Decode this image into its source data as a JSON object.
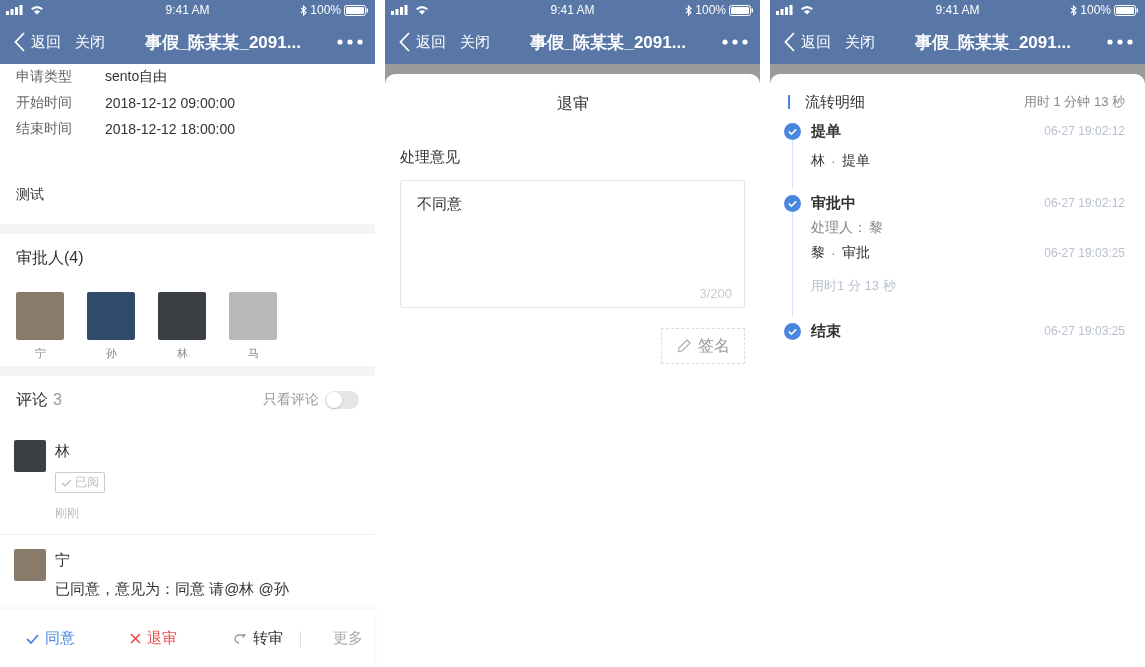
{
  "screens": [
    {
      "kind": "detail",
      "status_bar": {
        "time": "9:41 AM",
        "battery": "100%"
      },
      "nav_bar": {
        "back": "返回",
        "close": "关闭",
        "title": "事假_陈某某_2091..."
      },
      "fields": [
        {
          "label": "申请类型",
          "value": "sento自由"
        },
        {
          "label": "开始时间",
          "value": "2018-12-12 09:00:00"
        },
        {
          "label": "结束时间",
          "value": "2018-12-12 18:00:00"
        }
      ],
      "note": "测试",
      "approvers": {
        "title": "审批人(4)",
        "people": [
          {
            "name": "宁"
          },
          {
            "name": "孙"
          },
          {
            "name": "林"
          },
          {
            "name": "马"
          }
        ]
      },
      "comments": {
        "title": "评论",
        "count": "3",
        "filter": {
          "label": "只看评论",
          "on": false
        },
        "items": [
          {
            "author": "林",
            "badge": "已阅",
            "time": "刚刚"
          },
          {
            "author": "宁",
            "text": "已同意，意见为：同意 请@林 @孙"
          }
        ]
      },
      "actions": [
        {
          "kind": "approve",
          "label": "同意"
        },
        {
          "kind": "reject",
          "label": "退审"
        },
        {
          "kind": "transfer",
          "label": "转审"
        },
        {
          "kind": "more",
          "label": "更多"
        }
      ]
    },
    {
      "kind": "reject_sheet",
      "status_bar": {
        "time": "9:41 AM",
        "battery": "100%"
      },
      "nav_bar": {
        "back": "返回",
        "close": "关闭",
        "title": "事假_陈某某_2091..."
      },
      "sheet": {
        "title": "退审",
        "field_label": "处理意见",
        "value": "不同意",
        "counter": "3/200",
        "sign_button": "签名"
      }
    },
    {
      "kind": "flow_sheet",
      "status_bar": {
        "time": "9:41 AM",
        "battery": "100%"
      },
      "nav_bar": {
        "back": "返回",
        "close": "关闭",
        "title": "事假_陈某某_2091..."
      },
      "sheet": {
        "title": "流转明细",
        "total": "用时 1 分钟 13 秒",
        "steps": [
          {
            "title": "提单",
            "time": "06-27 19:02:12",
            "done": true,
            "details": [
              {
                "kind": "action",
                "actor": "林",
                "separator": "·",
                "action": "提单"
              }
            ]
          },
          {
            "title": "审批中",
            "time": "06-27 19:02:12",
            "done": true,
            "details": [
              {
                "kind": "handler",
                "label": "处理人：",
                "name": "黎"
              },
              {
                "kind": "action",
                "actor": "黎",
                "separator": "·",
                "action": "审批",
                "time": "06-27 19:03:25"
              },
              {
                "kind": "duration",
                "text": "用时1 分 13 秒"
              }
            ]
          },
          {
            "title": "结束",
            "time": "06-27 19:03:25",
            "done": true
          }
        ]
      }
    }
  ]
}
